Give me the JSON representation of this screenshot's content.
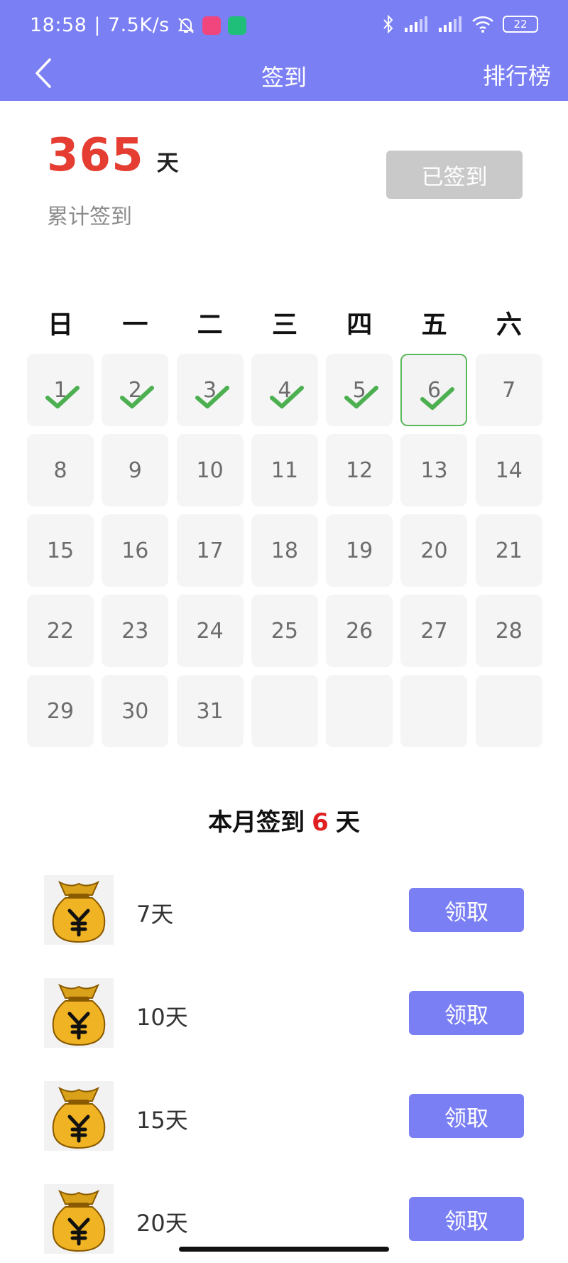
{
  "status_bar": {
    "time": "18:58",
    "speed": "7.5K/s",
    "battery": "22"
  },
  "nav": {
    "title": "签到",
    "right_label": "排行榜"
  },
  "summary": {
    "total_days": "365",
    "unit": "天",
    "label": "累计签到",
    "signed_button": "已签到"
  },
  "weekdays": [
    "日",
    "一",
    "二",
    "三",
    "四",
    "五",
    "六"
  ],
  "calendar": {
    "days": [
      "1",
      "2",
      "3",
      "4",
      "5",
      "6",
      "7",
      "8",
      "9",
      "10",
      "11",
      "12",
      "13",
      "14",
      "15",
      "16",
      "17",
      "18",
      "19",
      "20",
      "21",
      "22",
      "23",
      "24",
      "25",
      "26",
      "27",
      "28",
      "29",
      "30",
      "31",
      "",
      "",
      "",
      ""
    ],
    "checked_days": [
      1,
      2,
      3,
      4,
      5,
      6
    ],
    "today": 6
  },
  "month_summary": {
    "prefix": "本月签到",
    "count": "6",
    "suffix": "天"
  },
  "rewards": [
    {
      "label": "7天",
      "button": "领取"
    },
    {
      "label": "10天",
      "button": "领取"
    },
    {
      "label": "15天",
      "button": "领取"
    },
    {
      "label": "20天",
      "button": "领取"
    }
  ],
  "colors": {
    "accent": "#7b7ff4",
    "highlight_red": "#e53d32",
    "check_green": "#4caf50"
  }
}
